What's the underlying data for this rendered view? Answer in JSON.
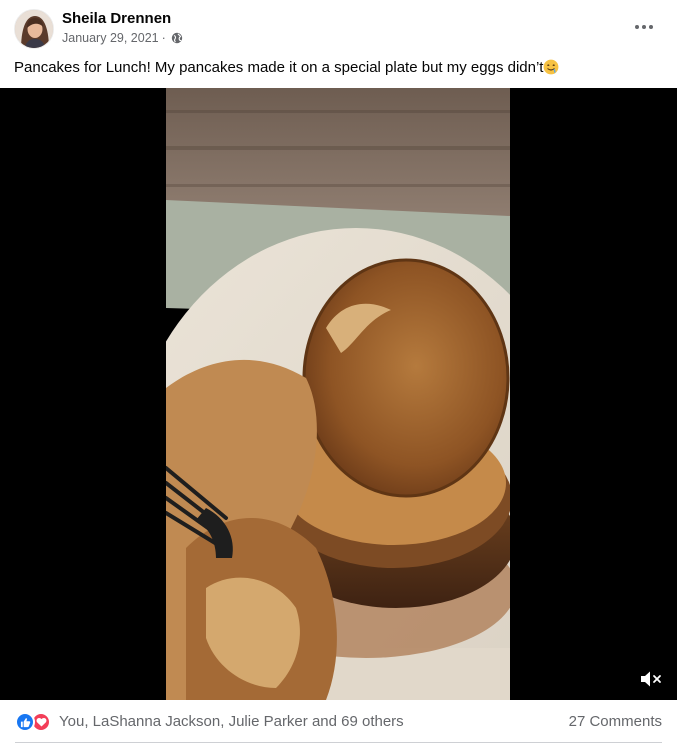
{
  "post": {
    "author_name": "Sheila Drennen",
    "date": "January 29, 2021",
    "separator": "·",
    "privacy_icon": "globe-icon",
    "text": "Pancakes for Lunch! My pancakes made it on a special plate but my eggs didn’t",
    "emoji": "drooling-face-emoji"
  },
  "video": {
    "description_icon": "pancake-video-frame",
    "mute_icon": "speaker-muted-icon"
  },
  "footer": {
    "reactions": [
      "like-icon",
      "love-icon"
    ],
    "reactors_text": "You, LaShanna Jackson, Julie Parker and 69 others",
    "comments_text": "27 Comments"
  },
  "colors": {
    "brand_blue": "#1877f2",
    "love_red": "#f33e58",
    "secondary_text": "#65676b",
    "primary_text": "#050505"
  }
}
